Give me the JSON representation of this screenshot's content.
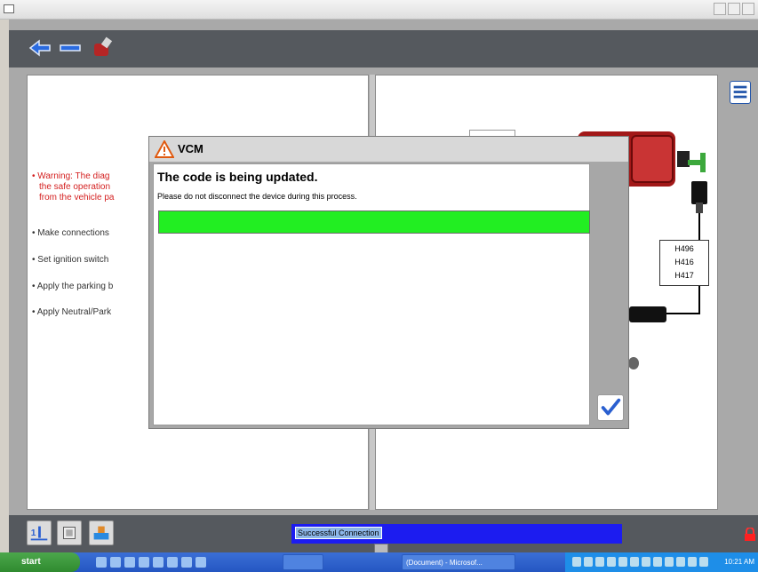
{
  "window": {
    "title": ""
  },
  "toolbar": {
    "buttons": [
      "back-icon",
      "forward-icon",
      "tools-icon"
    ]
  },
  "left_pane": {
    "warning_lines": [
      "• Warning: The diag",
      "the safe operation",
      "from the vehicle pa"
    ],
    "steps": [
      "• Make connections",
      "• Set ignition switch",
      "• Apply the parking b",
      "• Apply Neutral/Park"
    ]
  },
  "diagram": {
    "part_labels": [
      "H496",
      "H416",
      "H417"
    ]
  },
  "dialog": {
    "title": "VCM",
    "headline": "The code is being updated.",
    "message": "Please do not disconnect the device during this process.",
    "progress_percent": 100,
    "ok_icon": "checkmark-icon"
  },
  "statusbar": {
    "connection_status": "Successful Connection"
  },
  "taskbar": {
    "start_label": "start",
    "tasks": [
      "",
      "(Document) - Microsof..."
    ],
    "clock": "10:21 AM"
  },
  "colors": {
    "progress": "#22ee22",
    "toolbar": "#55595e",
    "status_blue": "#1c1cf0",
    "warning_red": "#d42020"
  }
}
